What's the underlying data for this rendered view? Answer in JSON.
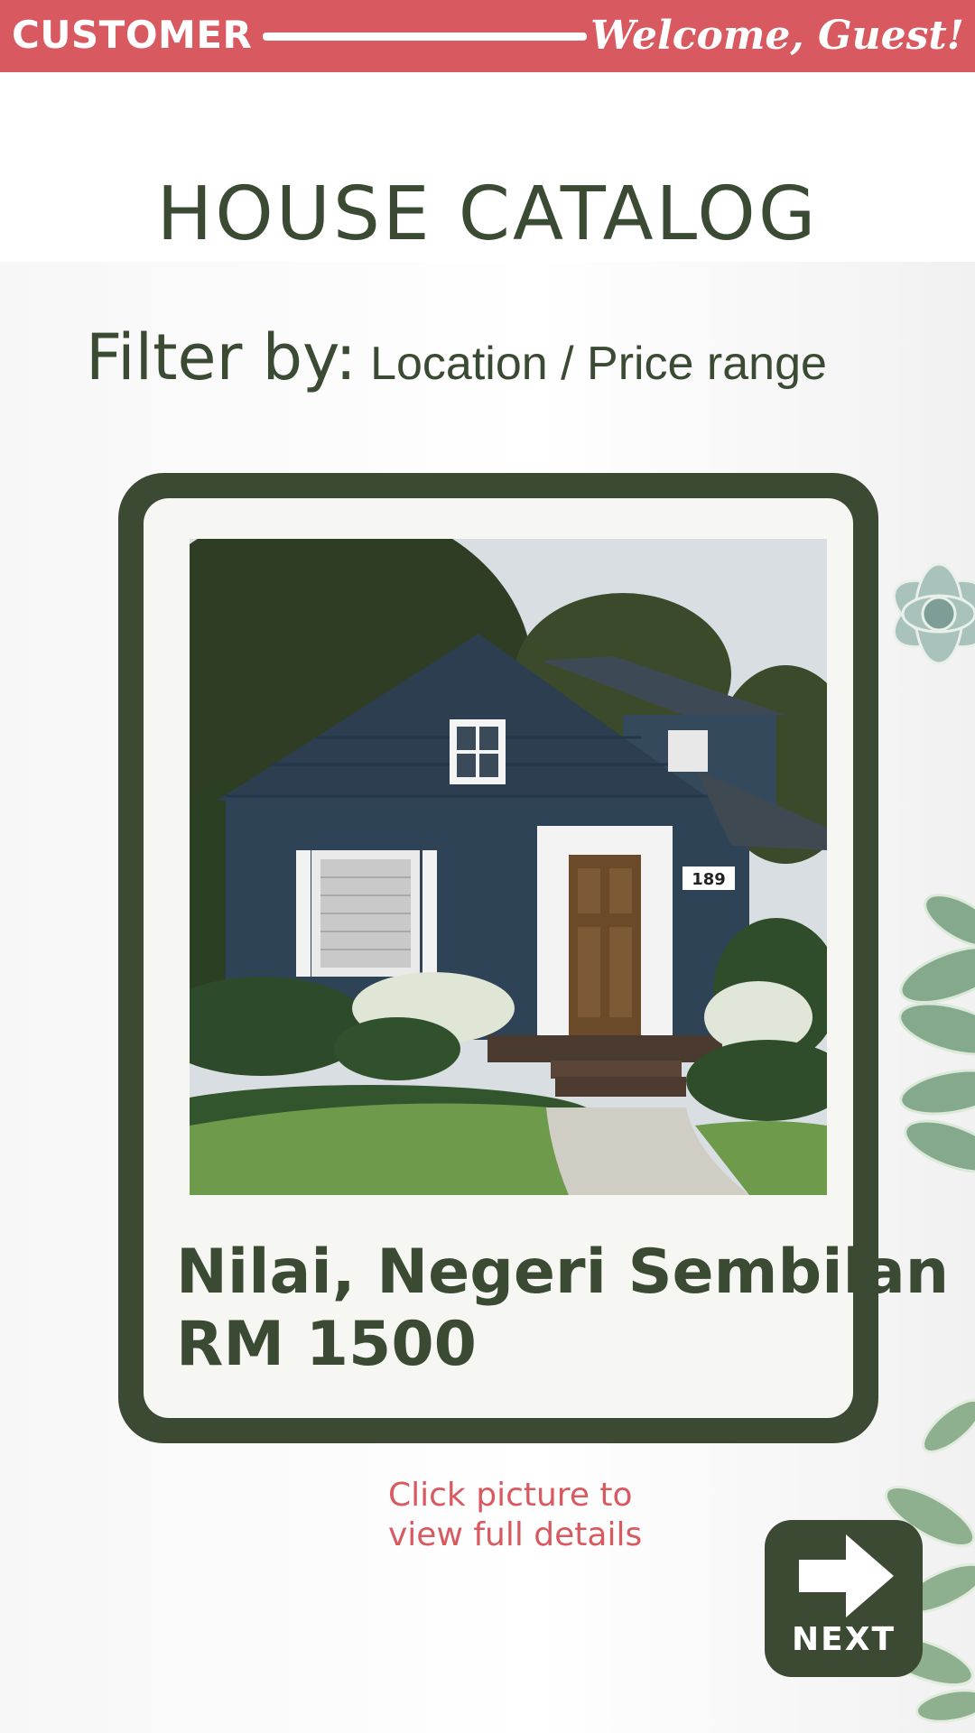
{
  "header": {
    "role_label": "CUSTOMER",
    "welcome_text": "Welcome, Guest!"
  },
  "page": {
    "title": "HOUSE CATALOG"
  },
  "filter": {
    "label": "Filter by:",
    "value": "Location / Price range"
  },
  "listing": {
    "location": "Nilai, Negeri Sembilan",
    "price": "RM 1500",
    "house_number": "189"
  },
  "hint": {
    "line1": "Click picture to",
    "line2": "view full details"
  },
  "next_button": {
    "label": "NEXT",
    "icon": "arrow-right-icon"
  },
  "colors": {
    "accent_red": "#d85a60",
    "dark_green": "#3d4a33",
    "card_bg": "#f6f7f3"
  }
}
